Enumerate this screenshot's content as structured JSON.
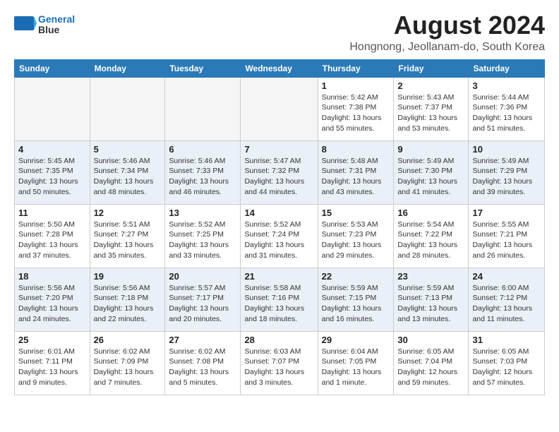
{
  "header": {
    "logo_line1": "General",
    "logo_line2": "Blue",
    "title": "August 2024",
    "subtitle": "Hongnong, Jeollanam-do, South Korea"
  },
  "days_of_week": [
    "Sunday",
    "Monday",
    "Tuesday",
    "Wednesday",
    "Thursday",
    "Friday",
    "Saturday"
  ],
  "weeks": [
    {
      "shade": false,
      "days": [
        {
          "num": "",
          "empty": true
        },
        {
          "num": "",
          "empty": true
        },
        {
          "num": "",
          "empty": true
        },
        {
          "num": "",
          "empty": true
        },
        {
          "num": "1",
          "info": "Sunrise: 5:42 AM\nSunset: 7:38 PM\nDaylight: 13 hours\nand 55 minutes."
        },
        {
          "num": "2",
          "info": "Sunrise: 5:43 AM\nSunset: 7:37 PM\nDaylight: 13 hours\nand 53 minutes."
        },
        {
          "num": "3",
          "info": "Sunrise: 5:44 AM\nSunset: 7:36 PM\nDaylight: 13 hours\nand 51 minutes."
        }
      ]
    },
    {
      "shade": true,
      "days": [
        {
          "num": "4",
          "info": "Sunrise: 5:45 AM\nSunset: 7:35 PM\nDaylight: 13 hours\nand 50 minutes."
        },
        {
          "num": "5",
          "info": "Sunrise: 5:46 AM\nSunset: 7:34 PM\nDaylight: 13 hours\nand 48 minutes."
        },
        {
          "num": "6",
          "info": "Sunrise: 5:46 AM\nSunset: 7:33 PM\nDaylight: 13 hours\nand 46 minutes."
        },
        {
          "num": "7",
          "info": "Sunrise: 5:47 AM\nSunset: 7:32 PM\nDaylight: 13 hours\nand 44 minutes."
        },
        {
          "num": "8",
          "info": "Sunrise: 5:48 AM\nSunset: 7:31 PM\nDaylight: 13 hours\nand 43 minutes."
        },
        {
          "num": "9",
          "info": "Sunrise: 5:49 AM\nSunset: 7:30 PM\nDaylight: 13 hours\nand 41 minutes."
        },
        {
          "num": "10",
          "info": "Sunrise: 5:49 AM\nSunset: 7:29 PM\nDaylight: 13 hours\nand 39 minutes."
        }
      ]
    },
    {
      "shade": false,
      "days": [
        {
          "num": "11",
          "info": "Sunrise: 5:50 AM\nSunset: 7:28 PM\nDaylight: 13 hours\nand 37 minutes."
        },
        {
          "num": "12",
          "info": "Sunrise: 5:51 AM\nSunset: 7:27 PM\nDaylight: 13 hours\nand 35 minutes."
        },
        {
          "num": "13",
          "info": "Sunrise: 5:52 AM\nSunset: 7:25 PM\nDaylight: 13 hours\nand 33 minutes."
        },
        {
          "num": "14",
          "info": "Sunrise: 5:52 AM\nSunset: 7:24 PM\nDaylight: 13 hours\nand 31 minutes."
        },
        {
          "num": "15",
          "info": "Sunrise: 5:53 AM\nSunset: 7:23 PM\nDaylight: 13 hours\nand 29 minutes."
        },
        {
          "num": "16",
          "info": "Sunrise: 5:54 AM\nSunset: 7:22 PM\nDaylight: 13 hours\nand 28 minutes."
        },
        {
          "num": "17",
          "info": "Sunrise: 5:55 AM\nSunset: 7:21 PM\nDaylight: 13 hours\nand 26 minutes."
        }
      ]
    },
    {
      "shade": true,
      "days": [
        {
          "num": "18",
          "info": "Sunrise: 5:56 AM\nSunset: 7:20 PM\nDaylight: 13 hours\nand 24 minutes."
        },
        {
          "num": "19",
          "info": "Sunrise: 5:56 AM\nSunset: 7:18 PM\nDaylight: 13 hours\nand 22 minutes."
        },
        {
          "num": "20",
          "info": "Sunrise: 5:57 AM\nSunset: 7:17 PM\nDaylight: 13 hours\nand 20 minutes."
        },
        {
          "num": "21",
          "info": "Sunrise: 5:58 AM\nSunset: 7:16 PM\nDaylight: 13 hours\nand 18 minutes."
        },
        {
          "num": "22",
          "info": "Sunrise: 5:59 AM\nSunset: 7:15 PM\nDaylight: 13 hours\nand 16 minutes."
        },
        {
          "num": "23",
          "info": "Sunrise: 5:59 AM\nSunset: 7:13 PM\nDaylight: 13 hours\nand 13 minutes."
        },
        {
          "num": "24",
          "info": "Sunrise: 6:00 AM\nSunset: 7:12 PM\nDaylight: 13 hours\nand 11 minutes."
        }
      ]
    },
    {
      "shade": false,
      "days": [
        {
          "num": "25",
          "info": "Sunrise: 6:01 AM\nSunset: 7:11 PM\nDaylight: 13 hours\nand 9 minutes."
        },
        {
          "num": "26",
          "info": "Sunrise: 6:02 AM\nSunset: 7:09 PM\nDaylight: 13 hours\nand 7 minutes."
        },
        {
          "num": "27",
          "info": "Sunrise: 6:02 AM\nSunset: 7:08 PM\nDaylight: 13 hours\nand 5 minutes."
        },
        {
          "num": "28",
          "info": "Sunrise: 6:03 AM\nSunset: 7:07 PM\nDaylight: 13 hours\nand 3 minutes."
        },
        {
          "num": "29",
          "info": "Sunrise: 6:04 AM\nSunset: 7:05 PM\nDaylight: 13 hours\nand 1 minute."
        },
        {
          "num": "30",
          "info": "Sunrise: 6:05 AM\nSunset: 7:04 PM\nDaylight: 12 hours\nand 59 minutes."
        },
        {
          "num": "31",
          "info": "Sunrise: 6:05 AM\nSunset: 7:03 PM\nDaylight: 12 hours\nand 57 minutes."
        }
      ]
    }
  ]
}
